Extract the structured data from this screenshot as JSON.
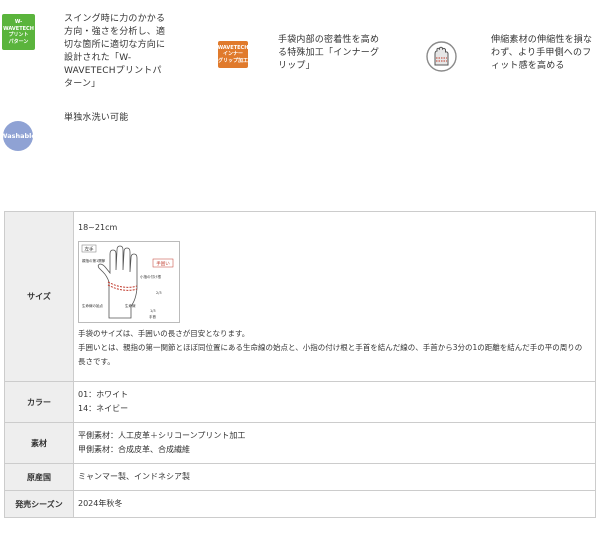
{
  "features": {
    "wave": {
      "icon_text": "W-WAVETECH\nプリント\nパターン",
      "text": "スイング時に力のかかる\n方向・強さを分析し、適\n切な箇所に適切な方向に\n設計された「W-\nWAVETECHプリントパ\nターン」",
      "color": "#5ab43c"
    },
    "grip": {
      "icon_text": "WAVETECH\nインナー\nグリップ加工",
      "text": "手袋内部の密着性を高め\nる特殊加工「インナーグ\nリップ」",
      "color": "#e07a2c"
    },
    "fit": {
      "icon": "hand-fit-icon",
      "text": "伸縮素材の伸縮性を損な\nわず、より手甲側へのフ\nィット感を高める"
    },
    "wash": {
      "icon_text": "Washable",
      "text": "単独水洗い可能",
      "color": "#8fa2d4"
    }
  },
  "spec": {
    "size": {
      "label": "サイズ",
      "value": "18~21cm",
      "diagram": {
        "hand_label": "左手",
        "size_label": "手囲い",
        "notes": [
          "親指の第1関節",
          "小指の付け根",
          "2/3",
          "1/3",
          "生命線の始点",
          "生命線",
          "手首"
        ]
      },
      "desc1": "手袋のサイズは、手囲いの長さが目安となります。",
      "desc2": "手囲いとは、親指の第一関節とほぼ同位置にある生命線の始点と、小指の付け根と手首を結んだ線の、手首から3分の1の距離を結んだ手の平の周りの長さです。"
    },
    "color": {
      "label": "カラー",
      "values": [
        "01：ホワイト",
        "14：ネイビー"
      ]
    },
    "material": {
      "label": "素材",
      "values": [
        "平側素材：人工皮革＋シリコーンプリント加工",
        "甲側素材：合成皮革、合成繊維"
      ]
    },
    "origin": {
      "label": "原産国",
      "value": "ミャンマー製、インドネシア製"
    },
    "release": {
      "label": "発売シーズン",
      "value": "2024年秋冬"
    }
  }
}
